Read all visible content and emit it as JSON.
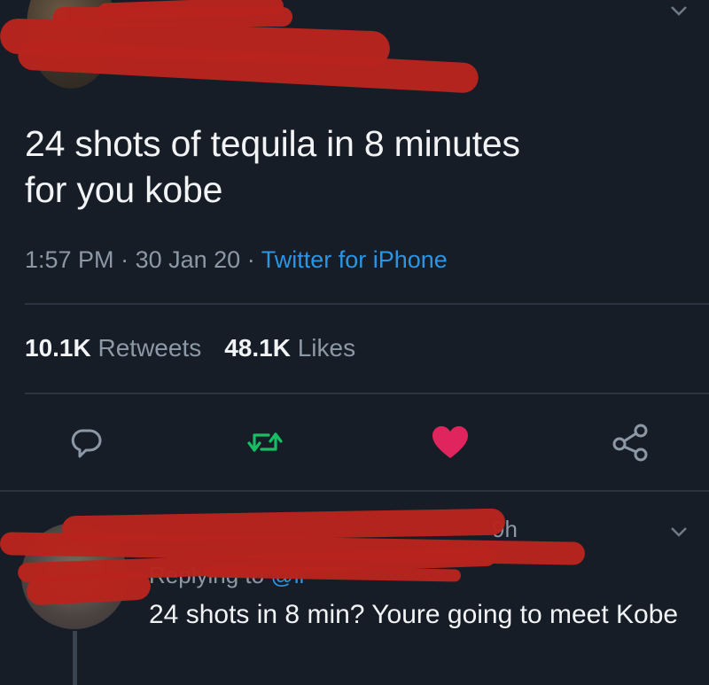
{
  "tweet": {
    "text_line1": "24 shots of tequila in 8 minutes",
    "text_line2": "for you kobe",
    "time": "1:57 PM",
    "date": "30 Jan 20",
    "separator": "·",
    "source": "Twitter for iPhone",
    "retweets_count": "10.1K",
    "retweets_label": "Retweets",
    "likes_count": "48.1K",
    "likes_label": "Likes",
    "liked": true
  },
  "reply": {
    "time_fragment": "9h",
    "replying_prefix": "Replying to",
    "handle_fragment": "li",
    "text": "24 shots in 8 min? Youre going to meet Kobe"
  },
  "colors": {
    "background": "#161d27",
    "link": "#2b95e4",
    "retweet_green": "#17bf63",
    "like_pink": "#e0245e",
    "redaction": "#b8241d"
  },
  "icons": {
    "reply": "reply-icon",
    "retweet": "retweet-icon",
    "like": "heart-icon",
    "share": "share-icon",
    "menu": "chevron-down-icon"
  }
}
